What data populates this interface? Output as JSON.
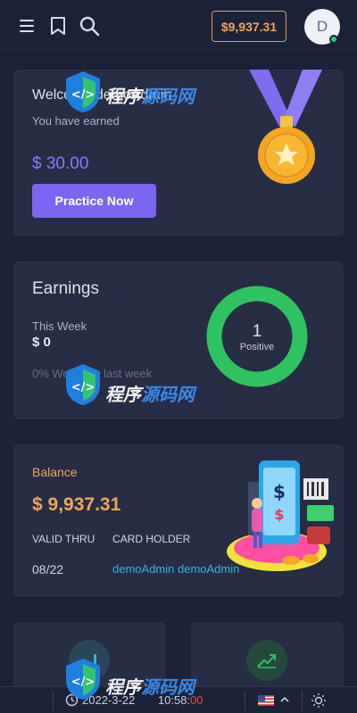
{
  "topbar": {
    "balance": "$9,937.31",
    "avatar_initial": "D"
  },
  "welcome": {
    "title": "Welcome demoAdmin",
    "subtitle": "You have earned",
    "amount": "$ 30.00",
    "button": "Practice Now"
  },
  "earnings": {
    "title": "Earnings",
    "period": "This Week",
    "amount": "$ 0",
    "note": "0% Welcome last week",
    "donut_value": "1",
    "donut_label": "Positive",
    "donut_fill": 1.0,
    "donut_color": "#2fc35f"
  },
  "balance": {
    "label": "Balance",
    "amount": "$ 9,937.31",
    "valid_thru_label": "VALID THRU",
    "card_holder_label": "CARD HOLDER",
    "valid_thru": "08/22",
    "card_holder": "demoAdmin demoAdmin"
  },
  "tiles": [
    {
      "icon": "bar-chart-icon"
    },
    {
      "icon": "trending-up-icon"
    }
  ],
  "footer": {
    "date": "2022-3-22",
    "time": "10:58:",
    "seconds": "00",
    "language": "us-flag-icon"
  },
  "watermark": {
    "prefix": "程序",
    "suffix": "源码网"
  },
  "colors": {
    "accent_purple": "#7a66f2",
    "accent_orange": "#f0a55b",
    "positive_green": "#2fc35f",
    "link_cyan": "#34b6d6",
    "background": "#1b2237",
    "card": "#262d44"
  }
}
